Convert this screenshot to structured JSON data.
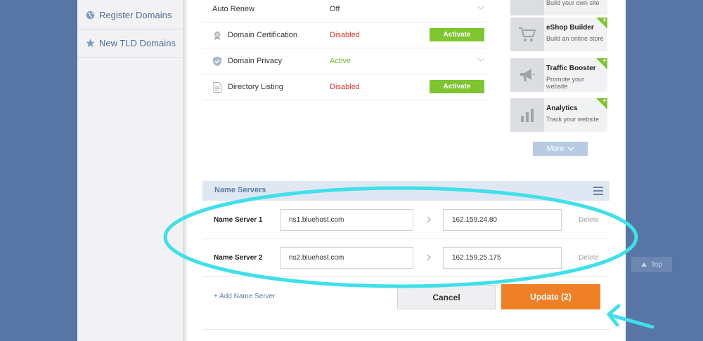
{
  "sidebar": {
    "items": [
      {
        "label": "Register Domains",
        "icon": "globe-icon"
      },
      {
        "label": "New TLD Domains",
        "icon": "star-icon"
      }
    ]
  },
  "addons": [
    {
      "label": "Auto Renew",
      "status": "Off",
      "status_type": "off",
      "icon": ""
    },
    {
      "label": "Domain Certification",
      "status": "Disabled",
      "status_type": "disabled",
      "action": "Activate",
      "icon": "certificate-icon"
    },
    {
      "label": "Domain Privacy",
      "status": "Active",
      "status_type": "active",
      "icon": "shield-icon"
    },
    {
      "label": "Directory Listing",
      "status": "Disabled",
      "status_type": "disabled",
      "action": "Activate",
      "icon": "document-icon"
    }
  ],
  "products": [
    {
      "title": "eShop Builder",
      "subtitle": "Build an online store",
      "icon": "shopping-cart-icon"
    },
    {
      "title": "Traffic Booster",
      "subtitle": "Promote your website",
      "icon": "megaphone-icon"
    },
    {
      "title": "Analytics",
      "subtitle": "Track your website",
      "icon": "bar-chart-icon"
    }
  ],
  "partial_product_subtitle": "Build your own site",
  "more_label": "More",
  "name_servers": {
    "title": "Name Servers",
    "rows": [
      {
        "label": "Name Server 1",
        "host": "ns1.bluehost.com",
        "ip": "162.159.24.80",
        "delete": "Delete"
      },
      {
        "label": "Name Server 2",
        "host": "ns2.bluehost.com",
        "ip": "162.159.25.175",
        "delete": "Delete"
      }
    ],
    "add_label": "+  Add Name Server",
    "cancel_label": "Cancel",
    "update_label": "Update (2)"
  },
  "top_label": "Top",
  "colors": {
    "background": "#5776a6",
    "activate": "#7fc431",
    "update": "#ef8026",
    "annotation": "#3fe0ea"
  }
}
